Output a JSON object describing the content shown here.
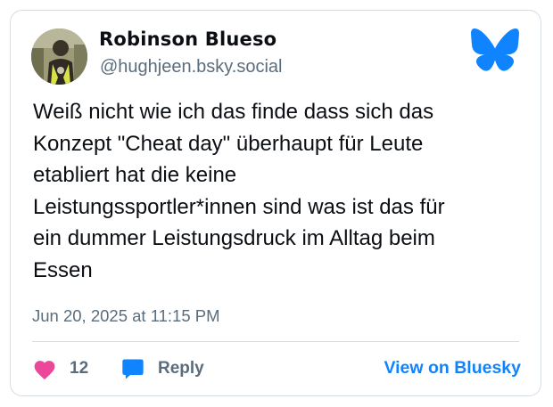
{
  "post": {
    "author": {
      "display_name": "Robinson Blueso",
      "handle": "@hughjeen.bsky.social"
    },
    "text": "Weiß nicht wie ich das finde dass sich das\nKonzept \"Cheat day\" überhaupt für Leute\netabliert hat die keine\nLeistungssportler*innen sind was ist das für\nein dummer Leistungsdruck im Alltag beim\nEssen",
    "timestamp": "Jun 20, 2025 at 11:15 PM",
    "likes_count": "12",
    "reply_label": "Reply",
    "view_link_label": "View on Bluesky"
  },
  "icons": {
    "brand": "bluesky-butterfly-icon",
    "like": "heart-icon",
    "reply": "speech-bubble-icon"
  },
  "colors": {
    "brand_blue": "#1083fe",
    "heart_pink": "#ec4899",
    "muted_text": "#5b6d7d",
    "border": "#d6dde3"
  }
}
